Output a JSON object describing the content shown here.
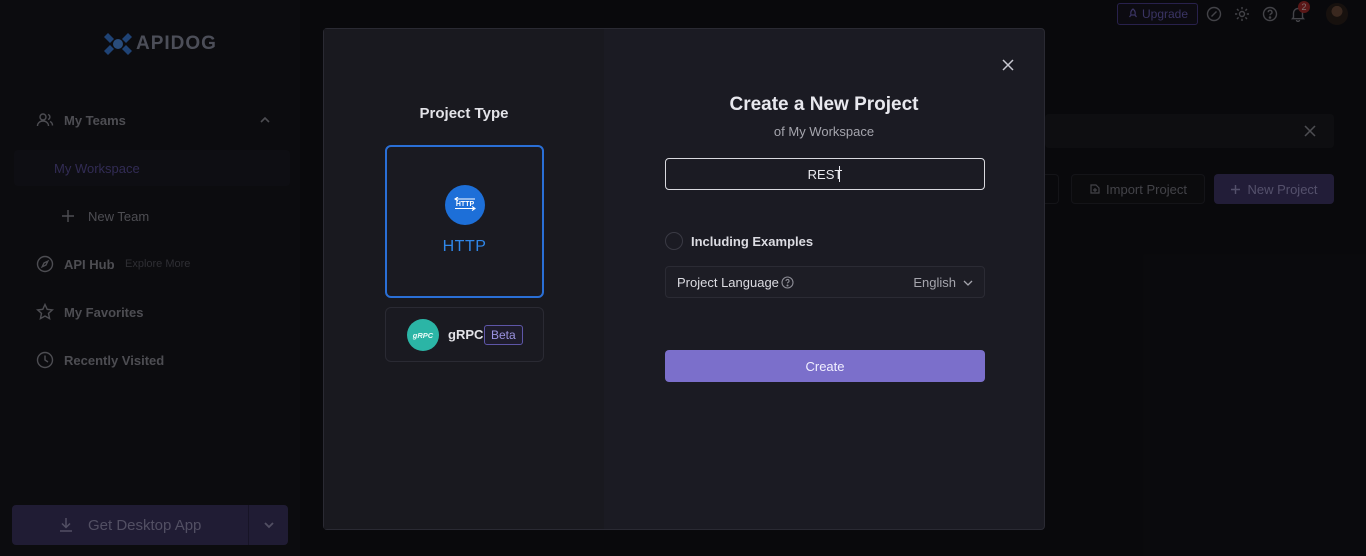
{
  "brand": {
    "name": "APIDOG"
  },
  "sidebar": {
    "teams_label": "My Teams",
    "workspace_label": "My Workspace",
    "new_team_label": "New Team",
    "api_hub_label": "API Hub",
    "api_hub_sub": "Explore More",
    "favorites_label": "My Favorites",
    "recent_label": "Recently Visited",
    "desktop_app_label": "Get Desktop App"
  },
  "topbar": {
    "upgrade_label": "Upgrade",
    "notification_count": "2"
  },
  "main": {
    "import_label": "Import Project",
    "new_project_label": "New Project"
  },
  "modal": {
    "project_type_title": "Project Type",
    "http_label": "HTTP",
    "grpc_label": "gRPC",
    "beta_label": "Beta",
    "title": "Create a New Project",
    "subtitle": "of My Workspace",
    "name_value": "REST",
    "include_examples_label": "Including Examples",
    "language_label": "Project Language",
    "language_value": "English",
    "create_label": "Create"
  },
  "colors": {
    "accent": "#7b6fcb",
    "http_blue": "#1d6fd8",
    "grpc_teal": "#2bb5a6"
  }
}
